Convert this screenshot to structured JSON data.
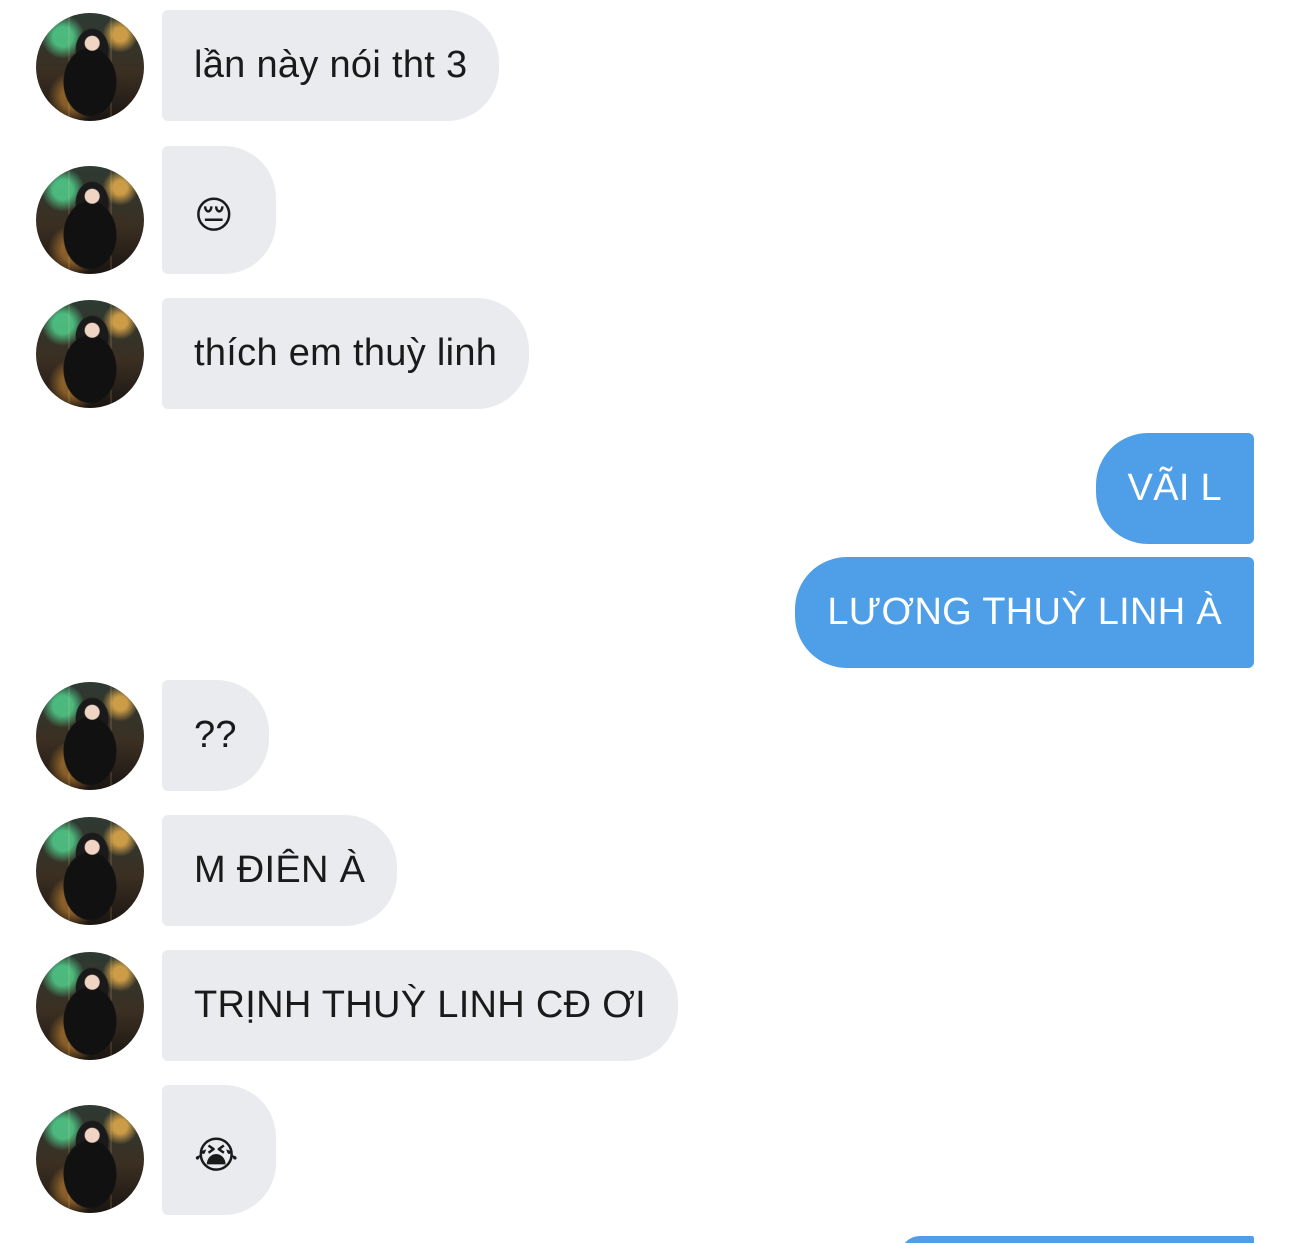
{
  "messages": [
    {
      "side": "in",
      "text": "lần này nói tht 3",
      "avatar": "contact-avatar"
    },
    {
      "side": "in",
      "text": "😔",
      "avatar": "contact-avatar"
    },
    {
      "side": "in",
      "text": "thích em thuỳ linh",
      "avatar": "contact-avatar"
    },
    {
      "side": "out",
      "text": "VÃI L"
    },
    {
      "side": "out",
      "text": "LƯƠNG THUỲ LINH À"
    },
    {
      "side": "in",
      "text": "??",
      "avatar": "contact-avatar"
    },
    {
      "side": "in",
      "text": "M ĐIÊN À",
      "avatar": "contact-avatar"
    },
    {
      "side": "in",
      "text": "TRỊNH THUỲ LINH CĐ ƠI",
      "avatar": "contact-avatar"
    },
    {
      "side": "in",
      "text": "😭",
      "avatar": "contact-avatar"
    }
  ],
  "colors": {
    "incoming_bubble": "#e9ebee",
    "outgoing_bubble": "#4f9ee8",
    "incoming_text": "#1a1a1a",
    "outgoing_text": "#ffffff"
  }
}
